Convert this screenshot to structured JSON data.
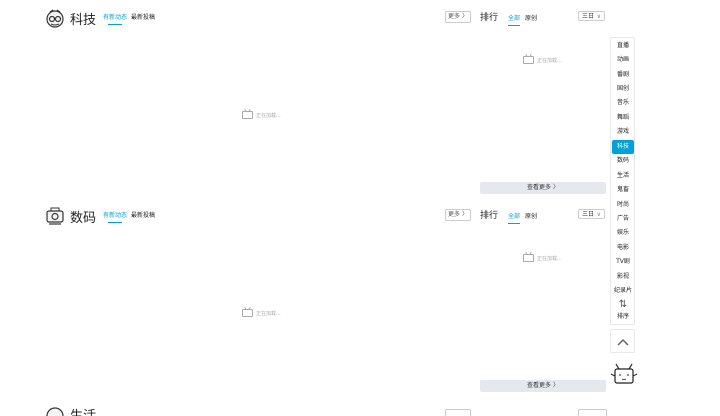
{
  "sections": [
    {
      "title": "科技",
      "tabs": [
        "有新动态",
        "最新投稿"
      ],
      "more": "更多",
      "rank_title": "排行",
      "rank_tabs": [
        "全部",
        "原创"
      ],
      "range": "三日",
      "loading_left": "正在加载...",
      "loading_right": "正在加载...",
      "see_more": "查看更多"
    },
    {
      "title": "数码",
      "tabs": [
        "有新动态",
        "最新投稿"
      ],
      "more": "更多",
      "rank_title": "排行",
      "rank_tabs": [
        "全部",
        "原创"
      ],
      "range": "三日",
      "loading_left": "正在加载...",
      "loading_right": "正在加载...",
      "see_more": "查看更多"
    },
    {
      "title": "生活"
    }
  ],
  "sidenav": {
    "items": [
      "直播",
      "动画",
      "番剧",
      "国创",
      "音乐",
      "舞蹈",
      "游戏",
      "科技",
      "数码",
      "生活",
      "鬼畜",
      "时尚",
      "广告",
      "娱乐",
      "电影",
      "TV剧",
      "影视",
      "纪录片"
    ],
    "active": "科技",
    "sort_label": "排序"
  },
  "colors": {
    "accent": "#00a1d6",
    "see_more_bg": "#e5e9ef"
  }
}
